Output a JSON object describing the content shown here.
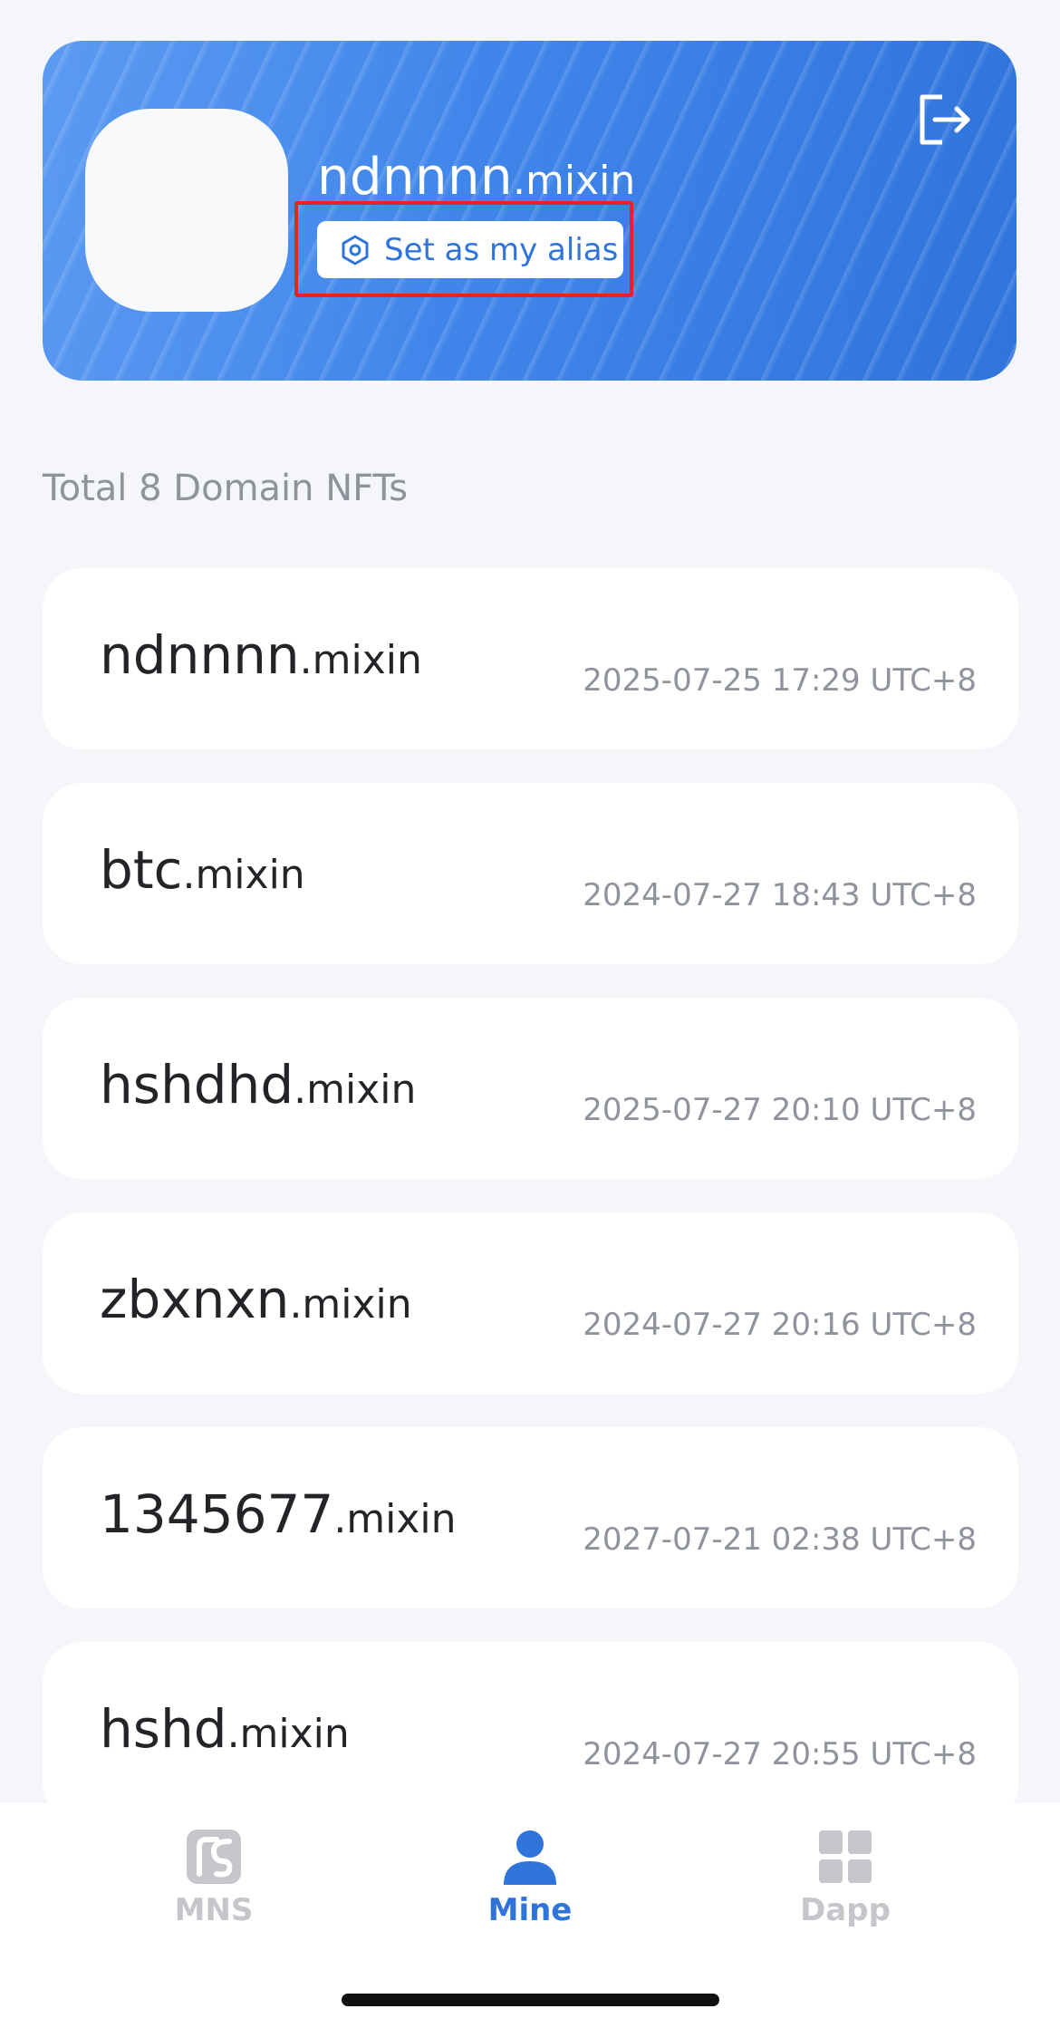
{
  "profile": {
    "name": "ndnnnn",
    "suffix": ".mixin",
    "alias_button_label": "Set as my alias",
    "icons": {
      "alias": "hexagon-gear-icon",
      "logout": "logout-icon"
    }
  },
  "section_title": "Total 8 Domain NFTs",
  "domains": [
    {
      "name": "ndnnnn",
      "suffix": ".mixin",
      "time": "2025-07-25 17:29 UTC+8"
    },
    {
      "name": "btc",
      "suffix": ".mixin",
      "time": "2024-07-27 18:43 UTC+8"
    },
    {
      "name": "hshdhd",
      "suffix": ".mixin",
      "time": "2025-07-27 20:10 UTC+8"
    },
    {
      "name": "zbxnxn",
      "suffix": ".mixin",
      "time": "2024-07-27 20:16 UTC+8"
    },
    {
      "name": "1345677",
      "suffix": ".mixin",
      "time": "2027-07-21 02:38 UTC+8"
    },
    {
      "name": "hshd",
      "suffix": ".mixin",
      "time": "2024-07-27 20:55 UTC+8"
    }
  ],
  "nav": {
    "items": [
      {
        "label": "MNS",
        "icon": "mns-logo-icon",
        "active": false
      },
      {
        "label": "Mine",
        "icon": "user-icon",
        "active": true
      },
      {
        "label": "Dapp",
        "icon": "grid-icon",
        "active": false
      }
    ]
  },
  "colors": {
    "accent": "#2f74db",
    "inactive": "#c4c6cb",
    "highlight": "#e82027",
    "background": "#f4f6fa"
  }
}
